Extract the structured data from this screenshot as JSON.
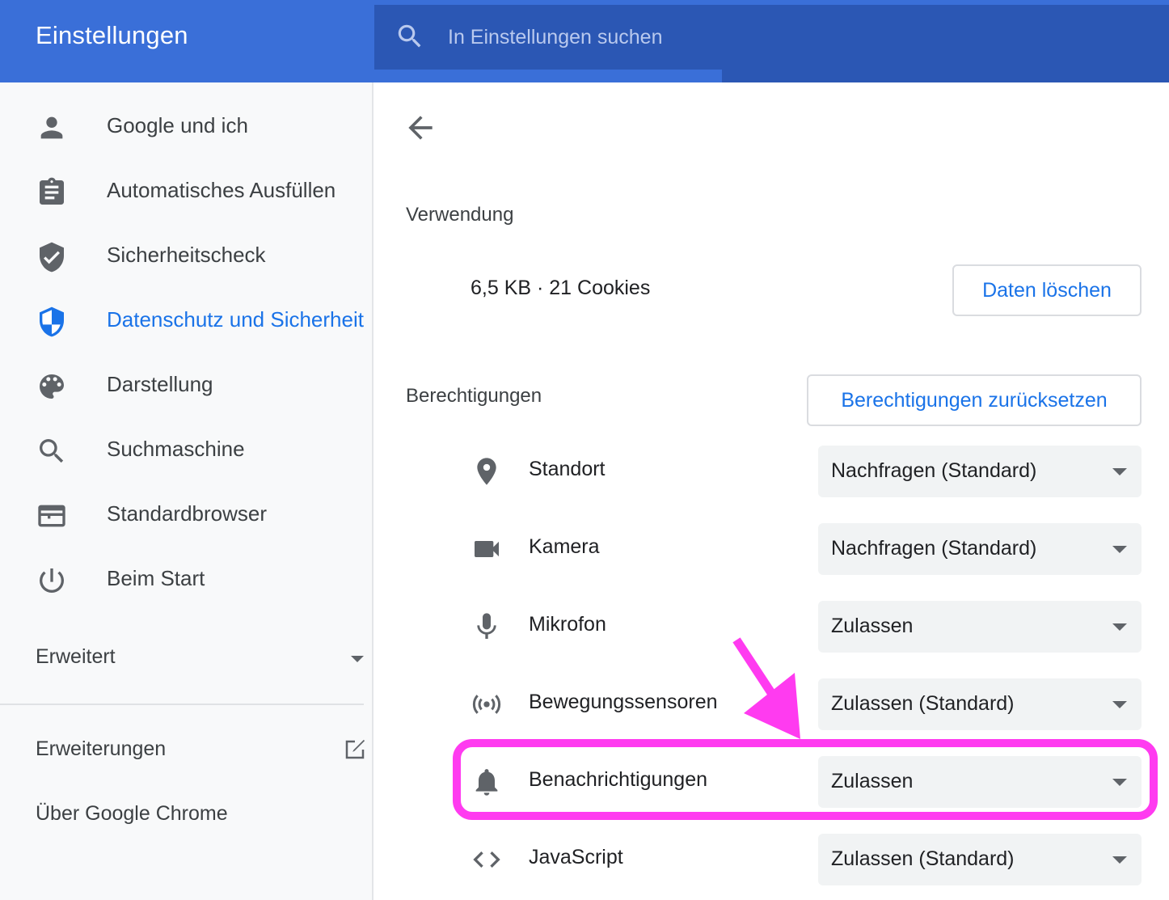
{
  "header": {
    "title": "Einstellungen",
    "search_placeholder": "In Einstellungen suchen"
  },
  "sidebar": {
    "items": [
      {
        "label": "Google und ich",
        "icon": "person-icon",
        "active": false
      },
      {
        "label": "Automatisches Ausfüllen",
        "icon": "clipboard-icon",
        "active": false
      },
      {
        "label": "Sicherheitscheck",
        "icon": "shield-check-icon",
        "active": false
      },
      {
        "label": "Datenschutz und Sicherheit",
        "icon": "shield-icon",
        "active": true
      },
      {
        "label": "Darstellung",
        "icon": "palette-icon",
        "active": false
      },
      {
        "label": "Suchmaschine",
        "icon": "search-icon",
        "active": false
      },
      {
        "label": "Standardbrowser",
        "icon": "browser-icon",
        "active": false
      },
      {
        "label": "Beim Start",
        "icon": "power-icon",
        "active": false
      }
    ],
    "advanced_label": "Erweitert",
    "extensions_label": "Erweiterungen",
    "about_label": "Über Google Chrome"
  },
  "main": {
    "usage": {
      "heading": "Verwendung",
      "summary": "6,5 KB · 21 Cookies",
      "clear_button": "Daten löschen"
    },
    "permissions": {
      "heading": "Berechtigungen",
      "reset_button": "Berechtigungen zurücksetzen",
      "rows": [
        {
          "label": "Standort",
          "icon": "location-pin-icon",
          "value": "Nachfragen (Standard)"
        },
        {
          "label": "Kamera",
          "icon": "camera-icon",
          "value": "Nachfragen (Standard)"
        },
        {
          "label": "Mikrofon",
          "icon": "microphone-icon",
          "value": "Zulassen"
        },
        {
          "label": "Bewegungssensoren",
          "icon": "motion-sensor-icon",
          "value": "Zulassen (Standard)"
        },
        {
          "label": "Benachrichtigungen",
          "icon": "bell-icon",
          "value": "Zulassen"
        },
        {
          "label": "JavaScript",
          "icon": "code-icon",
          "value": "Zulassen (Standard)"
        }
      ]
    }
  },
  "colors": {
    "header_bg": "#3a6fd8",
    "search_bg": "#2b57b4",
    "accent": "#1a73e8",
    "annotation": "#ff3bf0"
  }
}
